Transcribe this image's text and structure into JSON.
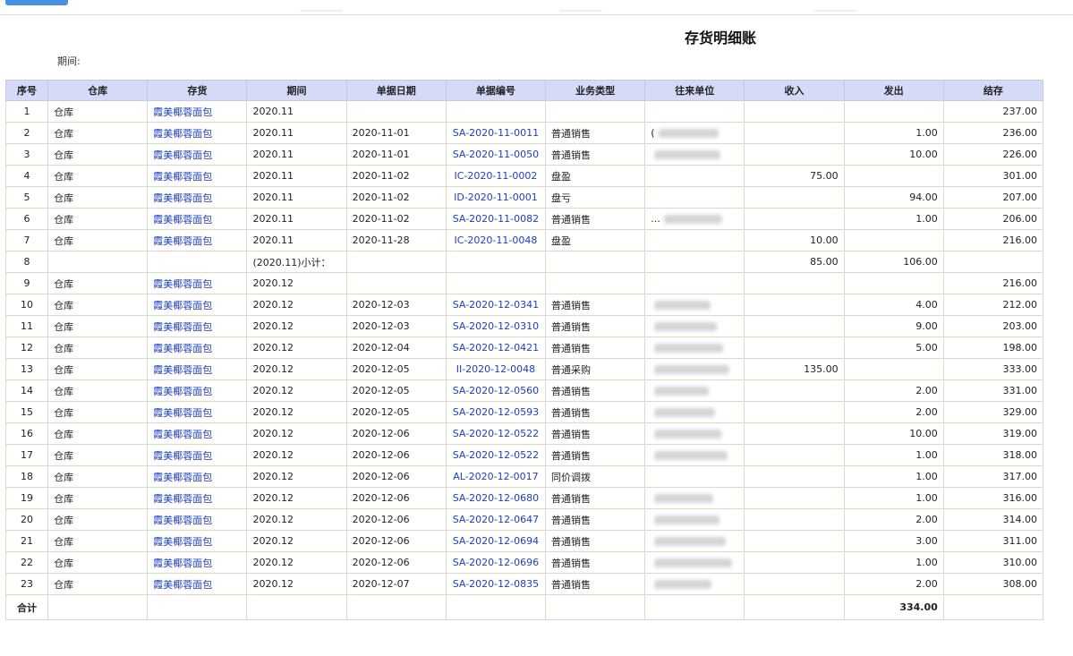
{
  "report": {
    "title": "存货明细账",
    "period_label": "期间:"
  },
  "table": {
    "columns": [
      "序号",
      "仓库",
      "存货",
      "期间",
      "单据日期",
      "单据编号",
      "业务类型",
      "往来单位",
      "收入",
      "发出",
      "结存"
    ],
    "rows": [
      {
        "seq": "1",
        "warehouse": "仓库",
        "item": "霞美椰蓉面包",
        "period": "2020.11",
        "date": "",
        "doc_no": "",
        "biz_type": "",
        "partner": "",
        "income": "",
        "issue": "",
        "balance": "237.00"
      },
      {
        "seq": "2",
        "warehouse": "仓库",
        "item": "霞美椰蓉面包",
        "period": "2020.11",
        "date": "2020-11-01",
        "doc_no": "SA-2020-11-0011",
        "biz_type": "普通销售",
        "partner": "(",
        "income": "",
        "issue": "1.00",
        "balance": "236.00"
      },
      {
        "seq": "3",
        "warehouse": "仓库",
        "item": "霞美椰蓉面包",
        "period": "2020.11",
        "date": "2020-11-01",
        "doc_no": "SA-2020-11-0050",
        "biz_type": "普通销售",
        "partner": "",
        "income": "",
        "issue": "10.00",
        "balance": "226.00"
      },
      {
        "seq": "4",
        "warehouse": "仓库",
        "item": "霞美椰蓉面包",
        "period": "2020.11",
        "date": "2020-11-02",
        "doc_no": "IC-2020-11-0002",
        "biz_type": "盘盈",
        "partner": "",
        "income": "75.00",
        "issue": "",
        "balance": "301.00"
      },
      {
        "seq": "5",
        "warehouse": "仓库",
        "item": "霞美椰蓉面包",
        "period": "2020.11",
        "date": "2020-11-02",
        "doc_no": "ID-2020-11-0001",
        "biz_type": "盘亏",
        "partner": "",
        "income": "",
        "issue": "94.00",
        "balance": "207.00"
      },
      {
        "seq": "6",
        "warehouse": "仓库",
        "item": "霞美椰蓉面包",
        "period": "2020.11",
        "date": "2020-11-02",
        "doc_no": "SA-2020-11-0082",
        "biz_type": "普通销售",
        "partner": "...",
        "income": "",
        "issue": "1.00",
        "balance": "206.00"
      },
      {
        "seq": "7",
        "warehouse": "仓库",
        "item": "霞美椰蓉面包",
        "period": "2020.11",
        "date": "2020-11-28",
        "doc_no": "IC-2020-11-0048",
        "biz_type": "盘盈",
        "partner": "",
        "income": "10.00",
        "issue": "",
        "balance": "216.00"
      },
      {
        "seq": "8",
        "warehouse": "",
        "item": "",
        "period": "(2020.11)小计：",
        "date": "",
        "doc_no": "",
        "biz_type": "",
        "partner": "",
        "income": "85.00",
        "issue": "106.00",
        "balance": ""
      },
      {
        "seq": "9",
        "warehouse": "仓库",
        "item": "霞美椰蓉面包",
        "period": "2020.12",
        "date": "",
        "doc_no": "",
        "biz_type": "",
        "partner": "",
        "income": "",
        "issue": "",
        "balance": "216.00"
      },
      {
        "seq": "10",
        "warehouse": "仓库",
        "item": "霞美椰蓉面包",
        "period": "2020.12",
        "date": "2020-12-03",
        "doc_no": "SA-2020-12-0341",
        "biz_type": "普通销售",
        "partner": "",
        "income": "",
        "issue": "4.00",
        "balance": "212.00"
      },
      {
        "seq": "11",
        "warehouse": "仓库",
        "item": "霞美椰蓉面包",
        "period": "2020.12",
        "date": "2020-12-03",
        "doc_no": "SA-2020-12-0310",
        "biz_type": "普通销售",
        "partner": "",
        "income": "",
        "issue": "9.00",
        "balance": "203.00"
      },
      {
        "seq": "12",
        "warehouse": "仓库",
        "item": "霞美椰蓉面包",
        "period": "2020.12",
        "date": "2020-12-04",
        "doc_no": "SA-2020-12-0421",
        "biz_type": "普通销售",
        "partner": "",
        "income": "",
        "issue": "5.00",
        "balance": "198.00"
      },
      {
        "seq": "13",
        "warehouse": "仓库",
        "item": "霞美椰蓉面包",
        "period": "2020.12",
        "date": "2020-12-05",
        "doc_no": "II-2020-12-0048",
        "biz_type": "普通采购",
        "partner": "",
        "income": "135.00",
        "issue": "",
        "balance": "333.00"
      },
      {
        "seq": "14",
        "warehouse": "仓库",
        "item": "霞美椰蓉面包",
        "period": "2020.12",
        "date": "2020-12-05",
        "doc_no": "SA-2020-12-0560",
        "biz_type": "普通销售",
        "partner": "",
        "income": "",
        "issue": "2.00",
        "balance": "331.00"
      },
      {
        "seq": "15",
        "warehouse": "仓库",
        "item": "霞美椰蓉面包",
        "period": "2020.12",
        "date": "2020-12-05",
        "doc_no": "SA-2020-12-0593",
        "biz_type": "普通销售",
        "partner": "",
        "income": "",
        "issue": "2.00",
        "balance": "329.00"
      },
      {
        "seq": "16",
        "warehouse": "仓库",
        "item": "霞美椰蓉面包",
        "period": "2020.12",
        "date": "2020-12-06",
        "doc_no": "SA-2020-12-0522",
        "biz_type": "普通销售",
        "partner": "",
        "income": "",
        "issue": "10.00",
        "balance": "319.00"
      },
      {
        "seq": "17",
        "warehouse": "仓库",
        "item": "霞美椰蓉面包",
        "period": "2020.12",
        "date": "2020-12-06",
        "doc_no": "SA-2020-12-0522",
        "biz_type": "普通销售",
        "partner": "",
        "income": "",
        "issue": "1.00",
        "balance": "318.00"
      },
      {
        "seq": "18",
        "warehouse": "仓库",
        "item": "霞美椰蓉面包",
        "period": "2020.12",
        "date": "2020-12-06",
        "doc_no": "AL-2020-12-0017",
        "biz_type": "同价调拨",
        "partner": "",
        "income": "",
        "issue": "1.00",
        "balance": "317.00"
      },
      {
        "seq": "19",
        "warehouse": "仓库",
        "item": "霞美椰蓉面包",
        "period": "2020.12",
        "date": "2020-12-06",
        "doc_no": "SA-2020-12-0680",
        "biz_type": "普通销售",
        "partner": "",
        "income": "",
        "issue": "1.00",
        "balance": "316.00"
      },
      {
        "seq": "20",
        "warehouse": "仓库",
        "item": "霞美椰蓉面包",
        "period": "2020.12",
        "date": "2020-12-06",
        "doc_no": "SA-2020-12-0647",
        "biz_type": "普通销售",
        "partner": "",
        "income": "",
        "issue": "2.00",
        "balance": "314.00"
      },
      {
        "seq": "21",
        "warehouse": "仓库",
        "item": "霞美椰蓉面包",
        "period": "2020.12",
        "date": "2020-12-06",
        "doc_no": "SA-2020-12-0694",
        "biz_type": "普通销售",
        "partner": "",
        "income": "",
        "issue": "3.00",
        "balance": "311.00"
      },
      {
        "seq": "22",
        "warehouse": "仓库",
        "item": "霞美椰蓉面包",
        "period": "2020.12",
        "date": "2020-12-06",
        "doc_no": "SA-2020-12-0696",
        "biz_type": "普通销售",
        "partner": "",
        "income": "",
        "issue": "1.00",
        "balance": "310.00"
      },
      {
        "seq": "23",
        "warehouse": "仓库",
        "item": "霞美椰蓉面包",
        "period": "2020.12",
        "date": "2020-12-07",
        "doc_no": "SA-2020-12-0835",
        "biz_type": "普通销售",
        "partner": "",
        "income": "",
        "issue": "2.00",
        "balance": "308.00"
      }
    ],
    "total": {
      "label": "合计",
      "issue": "334.00"
    }
  }
}
